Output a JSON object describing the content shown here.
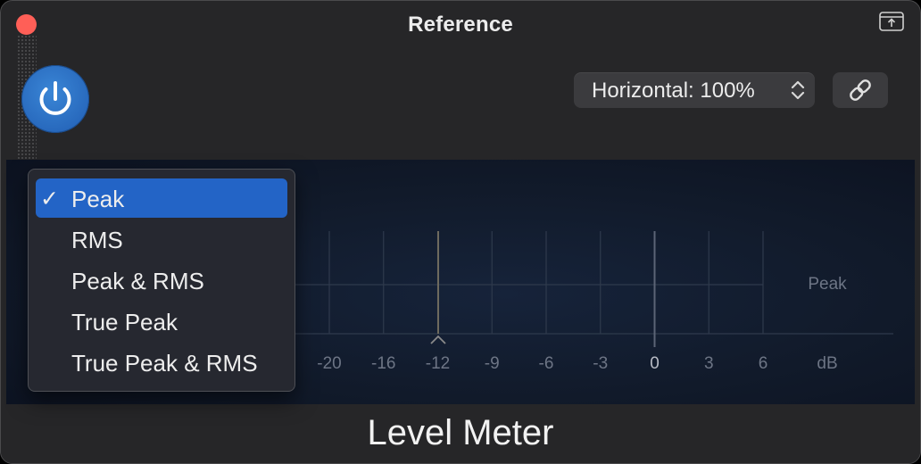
{
  "window": {
    "title": "Reference"
  },
  "toolbar": {
    "power_state": "on",
    "view_mode_label": "Horizontal: 100%"
  },
  "meter": {
    "mode_label": "Peak",
    "scale_ticks": [
      "-20",
      "-16",
      "-12",
      "-9",
      "-6",
      "-3",
      "0",
      "3",
      "6"
    ],
    "scale_unit": "dB"
  },
  "footer": {
    "label": "Level Meter"
  },
  "meter_mode_menu": {
    "selected_index": 0,
    "items": [
      {
        "label": "Peak",
        "checkmark": "✓"
      },
      {
        "label": "RMS"
      },
      {
        "label": "Peak & RMS"
      },
      {
        "label": "True Peak"
      },
      {
        "label": "True Peak & RMS"
      }
    ]
  },
  "colors": {
    "accent": "#2364c6",
    "power_button": "#2c6fc4",
    "close_button": "#ff5f57",
    "window_bg": "#262628",
    "meter_bg": "#111a2a"
  },
  "icons": {
    "close": "close-icon",
    "detach": "detach-window-icon",
    "power": "power-icon",
    "link": "link-icon",
    "stepper": "chevron-up-down-icon",
    "peak_marker": "caret-up-icon"
  }
}
